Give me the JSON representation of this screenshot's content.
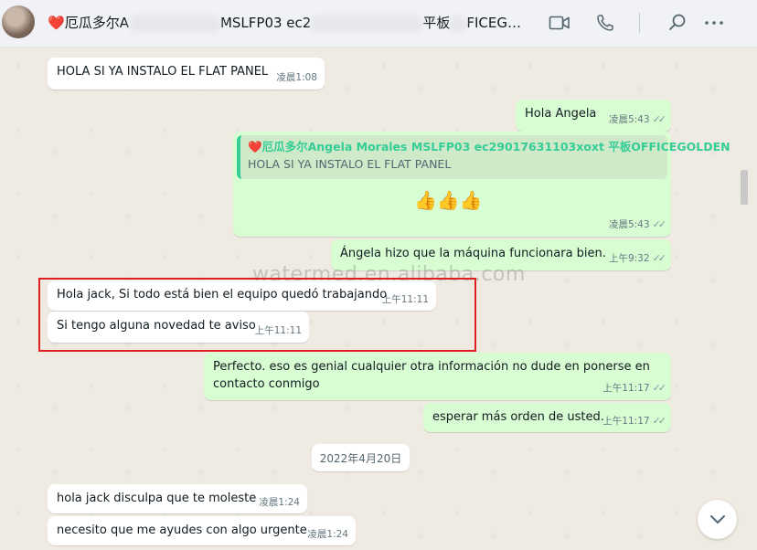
{
  "header": {
    "heart": "❤️",
    "title_part1": "厄瓜多尔A",
    "title_part2": "MSLFP03 ec2",
    "title_part3": "平板",
    "title_part4": "FICEG…"
  },
  "watermark": "watermed.en.alibaba.com",
  "messages": [
    {
      "text": "HOLA SI YA INSTALO EL FLAT PANEL",
      "time": "凌晨1:08"
    },
    {
      "text": "Hola Angela",
      "time": "凌晨5:43"
    },
    {
      "quote_author": "厄瓜多尔Angela Morales MSLFP03 ec29017631103xoxt 平板OFFICEGOLDEN",
      "quote_text": "HOLA SI YA INSTALO EL FLAT PANEL",
      "text": "👍👍👍",
      "time": "凌晨5:43"
    },
    {
      "text": "Ángela hizo que la máquina funcionara bien.",
      "time": "上午9:32"
    },
    {
      "text": "Hola jack, Si todo está bien el equipo quedó trabajando",
      "time": "上午11:11"
    },
    {
      "text": "Si tengo alguna novedad te aviso",
      "time": "上午11:11"
    },
    {
      "text": "Perfecto. eso es genial cualquier otra información no dude en ponerse en contacto conmigo",
      "time": "上午11:17"
    },
    {
      "text": "esperar más orden de usted.",
      "time": "上午11:17"
    },
    {
      "text": "hola jack disculpa que te moleste",
      "time": "凌晨1:24"
    },
    {
      "text": "necesito que me ayudes con algo urgente",
      "time": "凌晨1:24"
    }
  ],
  "date_separator": "2022年4月20日",
  "ticks": "✓✓",
  "colors": {
    "outgoing": "#d9fdd3",
    "incoming": "#ffffff",
    "highlight": "#e02020",
    "quote_accent": "#35cd96"
  }
}
